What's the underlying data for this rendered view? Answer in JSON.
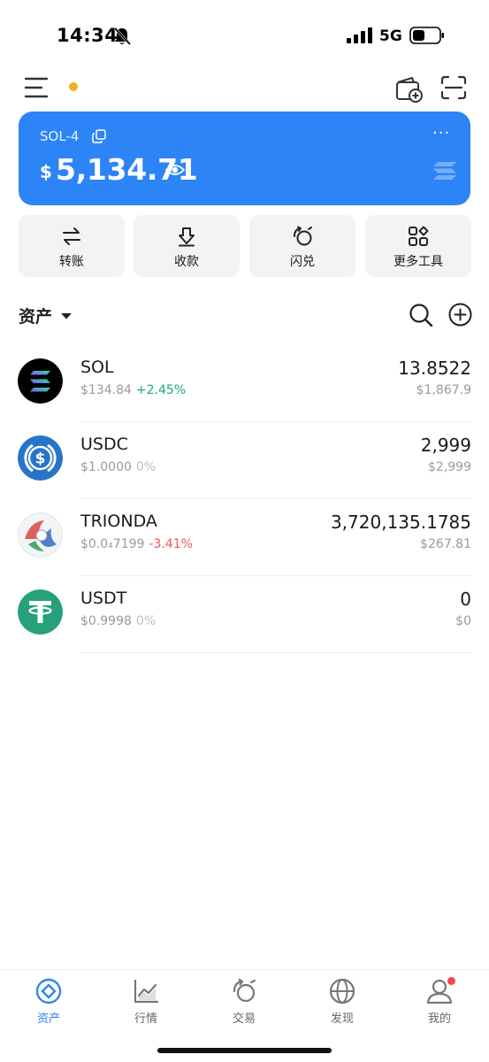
{
  "status_bar": {
    "time": "14:34",
    "network": "5G"
  },
  "wallet": {
    "name": "SOL-4",
    "currency_symbol": "$",
    "balance": "5,134.71",
    "more": "···"
  },
  "actions": [
    {
      "label": "转账",
      "icon": "transfer-icon"
    },
    {
      "label": "收款",
      "icon": "receive-icon"
    },
    {
      "label": "闪兑",
      "icon": "swap-icon"
    },
    {
      "label": "更多工具",
      "icon": "more-tools-icon"
    }
  ],
  "assets": {
    "title": "资产",
    "items": [
      {
        "symbol": "SOL",
        "price": "$134.84",
        "change": "+2.45%",
        "change_color": "#1fa971",
        "amount": "13.8522",
        "value": "$1,867.9"
      },
      {
        "symbol": "USDC",
        "price": "$1.0000",
        "change": "0%",
        "change_color": "#bdbdbd",
        "amount": "2,999",
        "value": "$2,999"
      },
      {
        "symbol": "TRIONDA",
        "price": "$0.0₄7199",
        "change": "-3.41%",
        "change_color": "#f0555a",
        "amount": "3,720,135.1785",
        "value": "$267.81"
      },
      {
        "symbol": "USDT",
        "price": "$0.9998",
        "change": "0%",
        "change_color": "#bdbdbd",
        "amount": "0",
        "value": "$0"
      }
    ]
  },
  "bottom_nav": [
    {
      "label": "资产",
      "icon": "assets-icon",
      "active": true
    },
    {
      "label": "行情",
      "icon": "market-icon",
      "active": false
    },
    {
      "label": "交易",
      "icon": "trade-icon",
      "active": false
    },
    {
      "label": "发现",
      "icon": "discover-icon",
      "active": false
    },
    {
      "label": "我的",
      "icon": "profile-icon",
      "active": false
    }
  ],
  "colors": {
    "accent": "#2d84f6",
    "notification_dot": "#f2b01e",
    "badge": "#f04a4a"
  }
}
